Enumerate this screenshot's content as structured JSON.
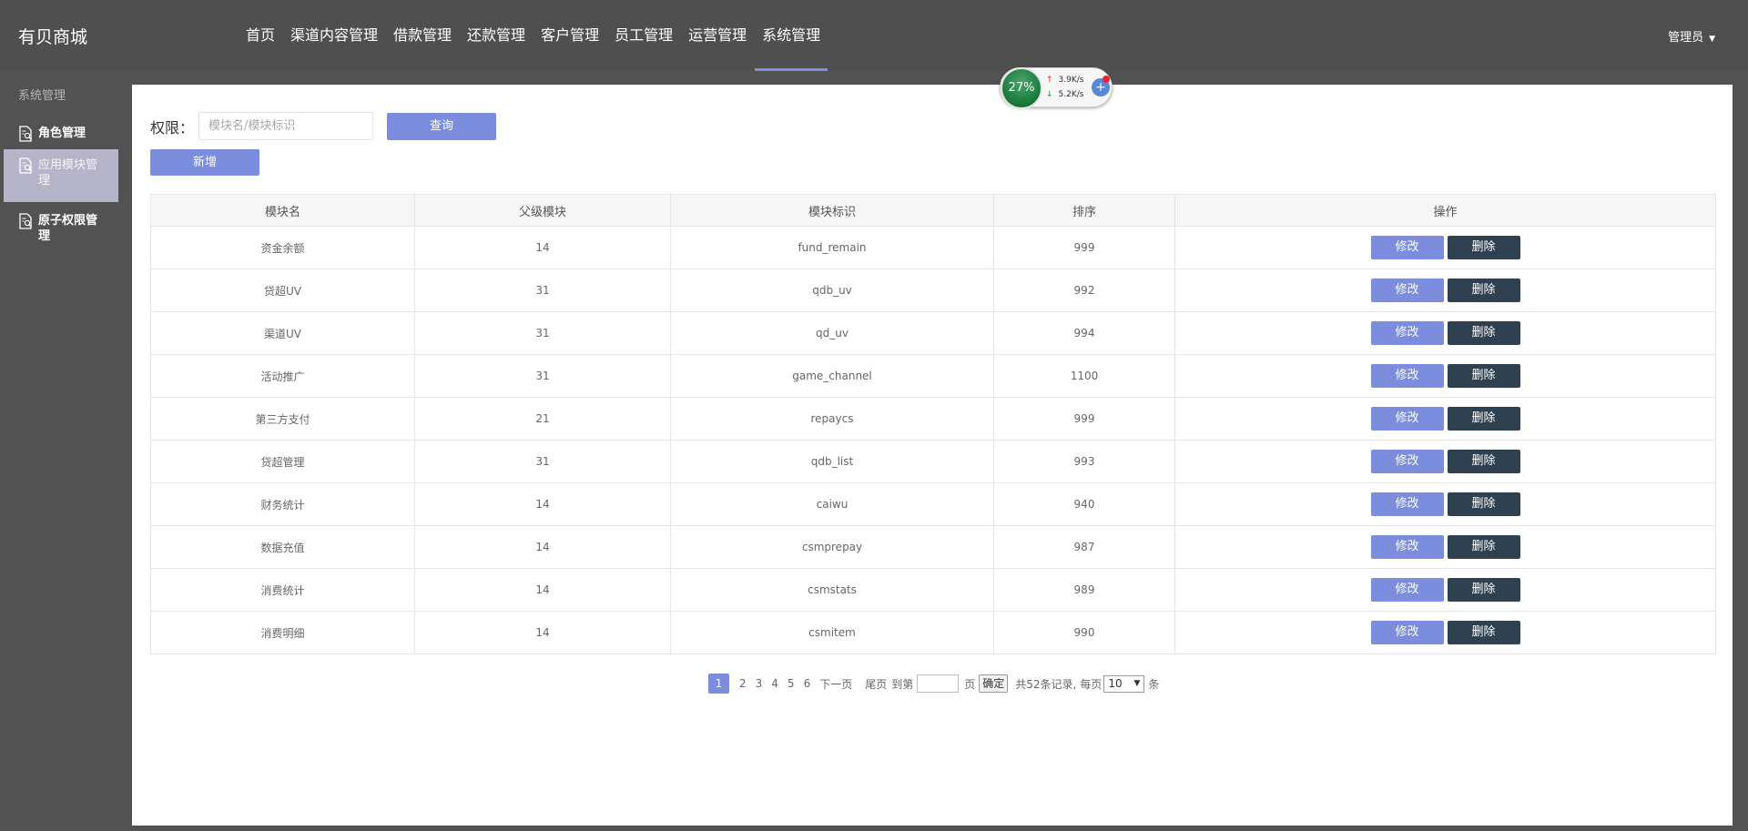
{
  "header": {
    "brand": "有贝商城",
    "nav": [
      "首页",
      "渠道内容管理",
      "借款管理",
      "还款管理",
      "客户管理",
      "员工管理",
      "运营管理",
      "系统管理"
    ],
    "active_nav": "系统管理",
    "user": "管理员",
    "user_caret": "▼"
  },
  "sidebar": {
    "section_title": "系统管理",
    "items": [
      {
        "label": "角色管理"
      },
      {
        "label": "应用模块管理"
      },
      {
        "label": "原子权限管理"
      }
    ],
    "active_item": "应用模块管理"
  },
  "filter": {
    "label": "权限：",
    "placeholder": "模块名/模块标识",
    "value": "",
    "query_button": "查询",
    "add_button": "新增"
  },
  "table": {
    "headers": [
      "模块名",
      "父级模块",
      "模块标识",
      "排序",
      "操作"
    ],
    "rows": [
      {
        "name": "资金余额",
        "parent": "14",
        "key": "fund_remain",
        "sort": "999"
      },
      {
        "name": "贷超UV",
        "parent": "31",
        "key": "qdb_uv",
        "sort": "992"
      },
      {
        "name": "渠道UV",
        "parent": "31",
        "key": "qd_uv",
        "sort": "994"
      },
      {
        "name": "活动推广",
        "parent": "31",
        "key": "game_channel",
        "sort": "1100"
      },
      {
        "name": "第三方支付",
        "parent": "21",
        "key": "repaycs",
        "sort": "999"
      },
      {
        "name": "贷超管理",
        "parent": "31",
        "key": "qdb_list",
        "sort": "993"
      },
      {
        "name": "财务统计",
        "parent": "14",
        "key": "caiwu",
        "sort": "940"
      },
      {
        "name": "数据充值",
        "parent": "14",
        "key": "csmprepay",
        "sort": "987"
      },
      {
        "name": "消费统计",
        "parent": "14",
        "key": "csmstats",
        "sort": "989"
      },
      {
        "name": "消费明细",
        "parent": "14",
        "key": "csmitem",
        "sort": "990"
      }
    ],
    "edit_label": "修改",
    "delete_label": "删除"
  },
  "pagination": {
    "current": "1",
    "pages": [
      "2",
      "3",
      "4",
      "5",
      "6"
    ],
    "next": "下一页",
    "last": "尾页",
    "goto_prefix": "到第",
    "goto_suffix": "页",
    "confirm": "确定",
    "total": "共52条记录,",
    "per_page_prefix": "每页",
    "per_page": "10",
    "per_page_suffix": "条"
  },
  "net_widget": {
    "percent": "27%",
    "upload": "3.9K/s",
    "download": "5.2K/s",
    "plus": "+"
  },
  "colors": {
    "accent": "#7b8ddc",
    "dark_button": "#2f4050",
    "topbar": "#4f4f4f",
    "sidebar_active": "#b6b4c8"
  }
}
